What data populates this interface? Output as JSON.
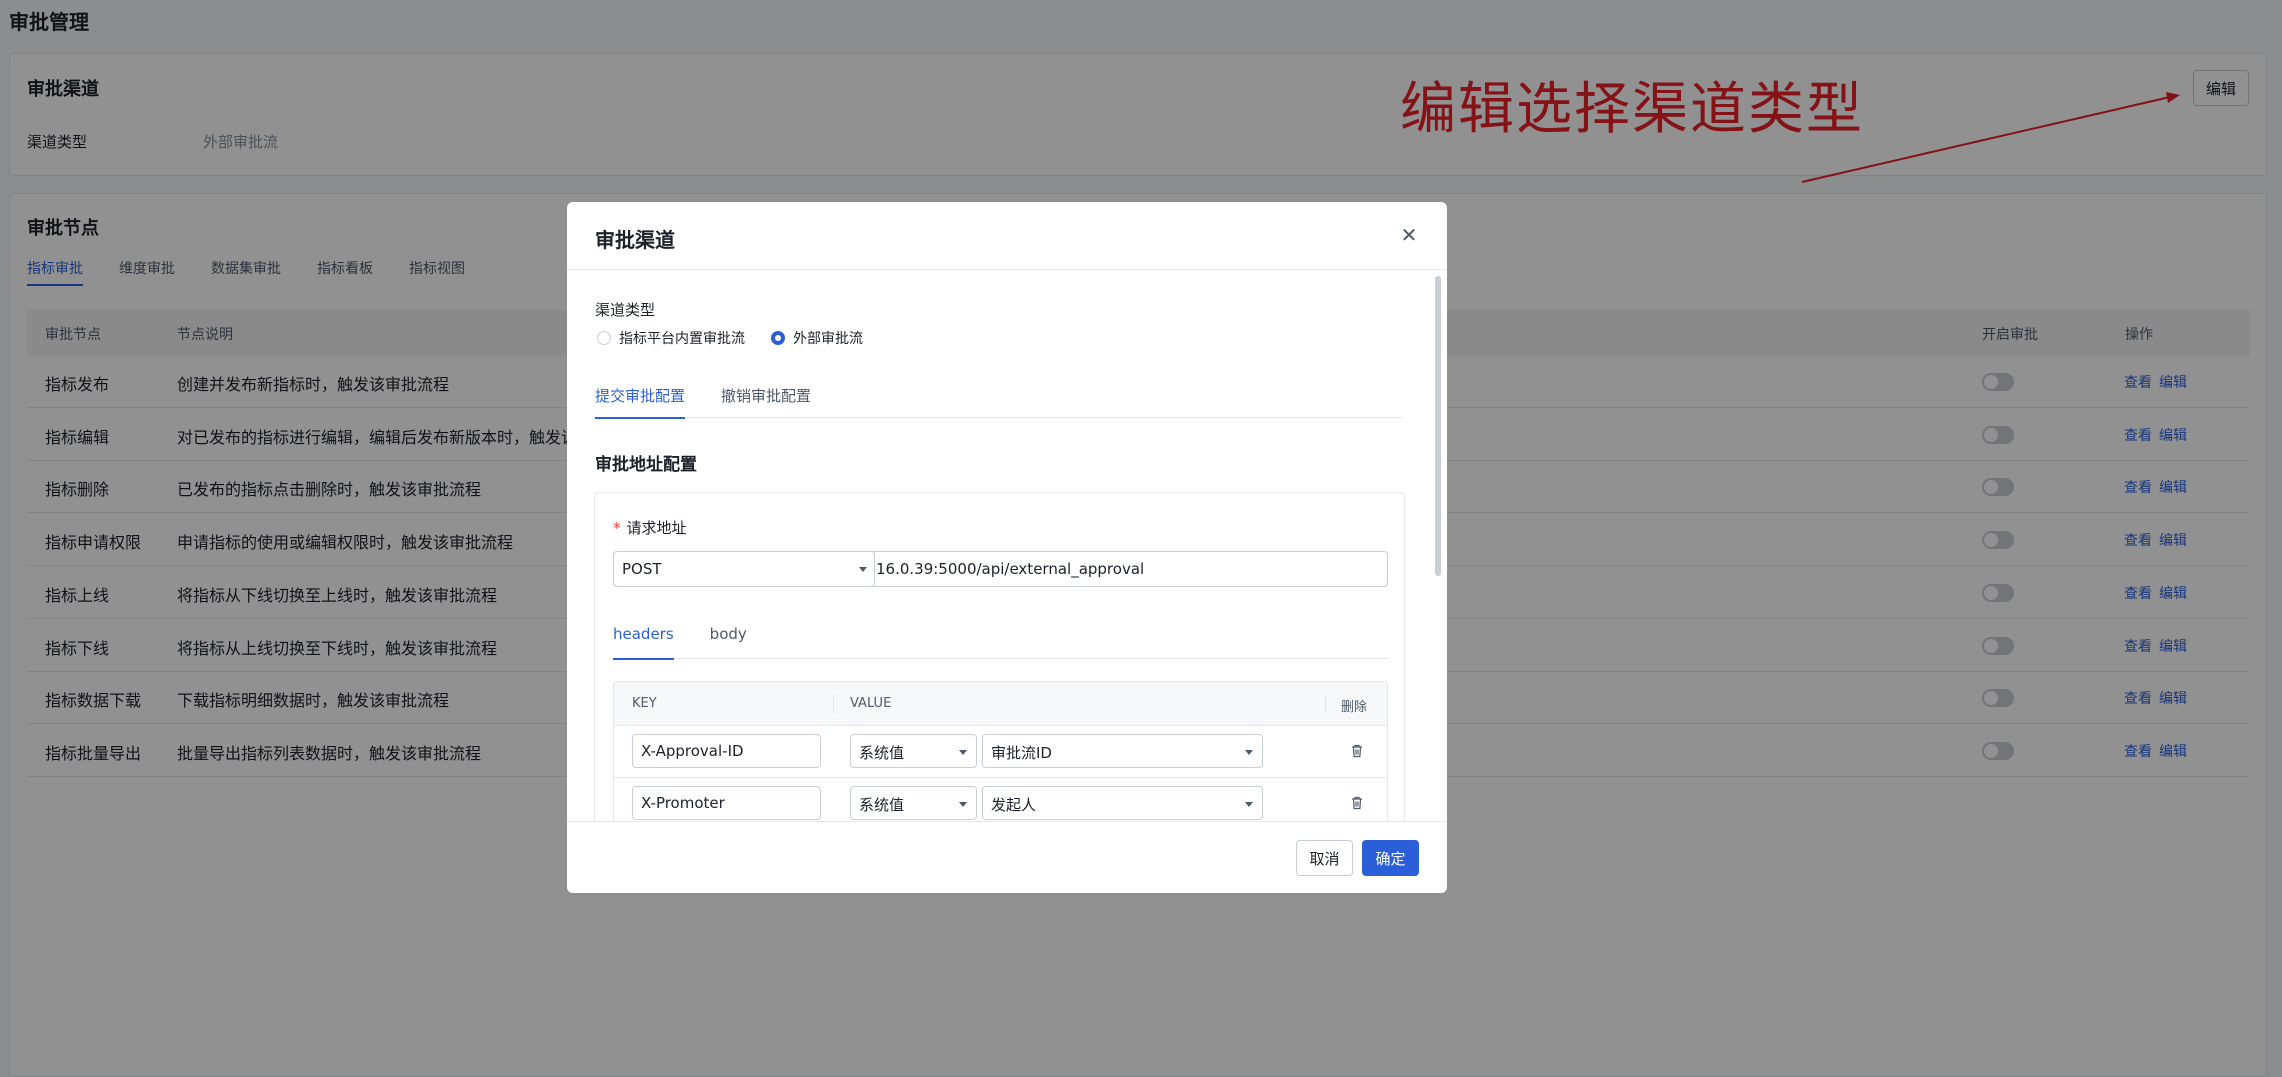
{
  "page": {
    "title": "审批管理"
  },
  "channel_card": {
    "title": "审批渠道",
    "edit_label": "编辑",
    "type_label": "渠道类型",
    "type_value": "外部审批流"
  },
  "annotation": {
    "text": "编辑选择渠道类型",
    "color": "#e8202a"
  },
  "nodes_card": {
    "title": "审批节点",
    "tabs": [
      {
        "label": "指标审批",
        "active": true
      },
      {
        "label": "维度审批"
      },
      {
        "label": "数据集审批"
      },
      {
        "label": "指标看板"
      },
      {
        "label": "指标视图"
      }
    ],
    "columns": {
      "node": "审批节点",
      "desc": "节点说明",
      "enabled": "开启审批",
      "actions": "操作"
    },
    "rows": [
      {
        "node": "指标发布",
        "desc": "创建并发布新指标时，触发该审批流程"
      },
      {
        "node": "指标编辑",
        "desc": "对已发布的指标进行编辑，编辑后发布新版本时，触发该审"
      },
      {
        "node": "指标删除",
        "desc": "已发布的指标点击删除时，触发该审批流程"
      },
      {
        "node": "指标申请权限",
        "desc": "申请指标的使用或编辑权限时，触发该审批流程"
      },
      {
        "node": "指标上线",
        "desc": "将指标从下线切换至上线时，触发该审批流程"
      },
      {
        "node": "指标下线",
        "desc": "将指标从上线切换至下线时，触发该审批流程"
      },
      {
        "node": "指标数据下载",
        "desc": "下载指标明细数据时，触发该审批流程"
      },
      {
        "node": "指标批量导出",
        "desc": "批量导出指标列表数据时，触发该审批流程"
      }
    ],
    "view_label": "查看",
    "edit_label": "编辑"
  },
  "modal": {
    "title": "审批渠道",
    "channel_type_label": "渠道类型",
    "radio_options": [
      {
        "label": "指标平台内置审批流",
        "checked": false
      },
      {
        "label": "外部审批流",
        "checked": true
      }
    ],
    "tabs": [
      {
        "label": "提交审批配置",
        "active": true
      },
      {
        "label": "撤销审批配置"
      }
    ],
    "section_title": "审批地址配置",
    "request_label": "请求地址",
    "method": "POST",
    "url": "16.0.39:5000/api/external_approval",
    "sub_tabs": [
      {
        "label": "headers",
        "active": true
      },
      {
        "label": "body"
      }
    ],
    "kv_columns": {
      "key": "KEY",
      "value": "VALUE",
      "delete": "删除"
    },
    "kv_rows": [
      {
        "key": "X-Approval-ID",
        "type": "系统值",
        "value": "审批流ID"
      },
      {
        "key": "X-Promoter",
        "type": "系统值",
        "value": "发起人"
      }
    ],
    "cancel_label": "取消",
    "ok_label": "确定"
  },
  "colors": {
    "primary": "#2b5fd9",
    "annotation": "#e8202a",
    "required": "#f53f3f"
  }
}
